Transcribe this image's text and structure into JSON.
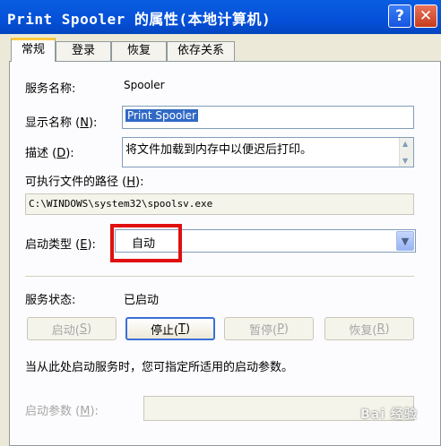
{
  "window": {
    "title": "Print Spooler 的属性(本地计算机)",
    "help_glyph": "?",
    "close_glyph": "✕"
  },
  "tabs": [
    {
      "label": "常规",
      "active": true
    },
    {
      "label": "登录",
      "active": false
    },
    {
      "label": "恢复",
      "active": false
    },
    {
      "label": "依存关系",
      "active": false
    }
  ],
  "general": {
    "service_name_label": "服务名称:",
    "service_name_value": "Spooler",
    "display_name_label_pre": "显示名称 (",
    "display_name_label_key": "N",
    "display_name_label_post": "):",
    "display_name_value": "Print Spooler",
    "description_label_pre": "描述 (",
    "description_label_key": "D",
    "description_label_post": "):",
    "description_value": "将文件加载到内存中以便迟后打印。",
    "exe_path_label_pre": "可执行文件的路径 (",
    "exe_path_label_key": "H",
    "exe_path_label_post": "):",
    "exe_path_value": "C:\\WINDOWS\\system32\\spoolsv.exe",
    "startup_type_label_pre": "启动类型 (",
    "startup_type_label_key": "E",
    "startup_type_label_post": "):",
    "startup_type_value": "自动",
    "service_status_label": "服务状态:",
    "service_status_value": "已启动",
    "buttons": {
      "start": {
        "pre": "启动(",
        "key": "S",
        "post": ")",
        "enabled": false
      },
      "stop": {
        "pre": "停止(",
        "key": "T",
        "post": ")",
        "enabled": true
      },
      "pause": {
        "pre": "暂停(",
        "key": "P",
        "post": ")",
        "enabled": false
      },
      "resume": {
        "pre": "恢复(",
        "key": "R",
        "post": ")",
        "enabled": false
      }
    },
    "hint": "当从此处启动服务时，您可指定所适用的启动参数。",
    "start_params_label_pre": "启动参数 (",
    "start_params_label_key": "M",
    "start_params_label_post": "):",
    "start_params_value": ""
  },
  "watermark": "Bai 经验",
  "colors": {
    "titlebar": "#0550d8",
    "highlight": "#e01010",
    "selection": "#316ac5"
  }
}
